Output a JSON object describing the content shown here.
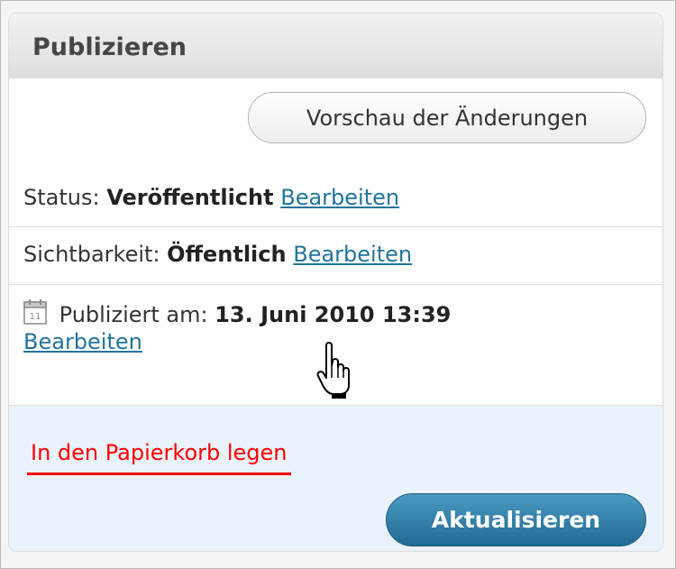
{
  "panel": {
    "title": "Publizieren",
    "preview_button_label": "Vorschau der Änderungen"
  },
  "status": {
    "label": "Status:",
    "value": "Veröffentlicht",
    "edit_link": "Bearbeiten"
  },
  "visibility": {
    "label": "Sichtbarkeit:",
    "value": "Öffentlich",
    "edit_link": "Bearbeiten"
  },
  "published": {
    "calendar_day": "11",
    "label": "Publiziert am:",
    "value": "13. Juni 2010 13:39",
    "edit_link": "Bearbeiten"
  },
  "footer": {
    "trash_link": "In den Papierkorb legen",
    "update_button_label": "Aktualisieren"
  },
  "icons": [
    "calendar-icon",
    "hand-pointer-cursor-icon"
  ],
  "colors": {
    "link": "#21759b",
    "trash": "#ff0000",
    "primary_button": "#2a7aa6",
    "footer_background": "#eaf2fa"
  }
}
